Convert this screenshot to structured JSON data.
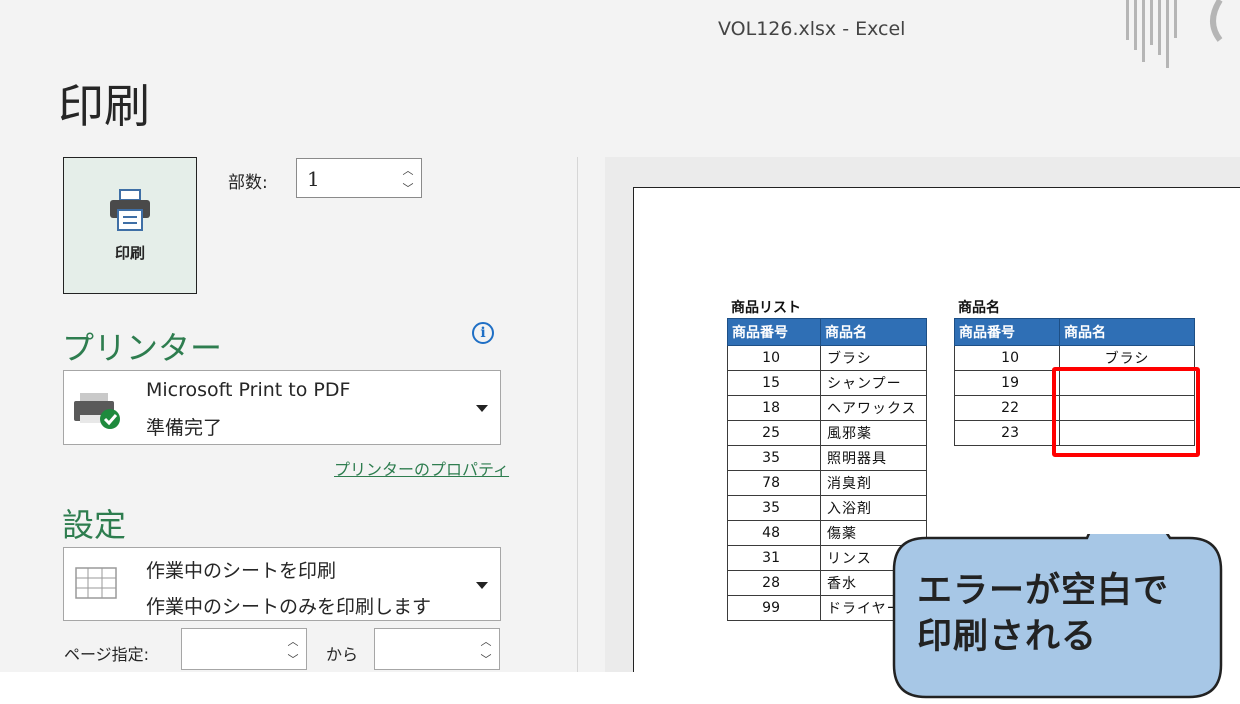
{
  "window": {
    "title": "VOL126.xlsx  -  Excel"
  },
  "page": {
    "title": "印刷"
  },
  "print_button": {
    "label": "印刷",
    "icon": "printer-icon"
  },
  "copies": {
    "label": "部数:",
    "value": "1"
  },
  "printer": {
    "heading": "プリンター",
    "name": "Microsoft Print to PDF",
    "status": "準備完了",
    "properties_link": "プリンターのプロパティ",
    "info_icon": "info-icon"
  },
  "settings": {
    "heading": "設定",
    "scope_title": "作業中のシートを印刷",
    "scope_desc": "作業中のシートのみを印刷します",
    "pages_label": "ページ指定:",
    "pages_to": "から"
  },
  "preview": {
    "list_title": "商品リスト",
    "list_headers": [
      "商品番号",
      "商品名"
    ],
    "list_rows": [
      [
        "10",
        "ブラシ"
      ],
      [
        "15",
        "シャンプー"
      ],
      [
        "18",
        "ヘアワックス"
      ],
      [
        "25",
        "風邪薬"
      ],
      [
        "35",
        "照明器具"
      ],
      [
        "78",
        "消臭剤"
      ],
      [
        "35",
        "入浴剤"
      ],
      [
        "48",
        "傷薬"
      ],
      [
        "31",
        "リンス"
      ],
      [
        "28",
        "香水"
      ],
      [
        "99",
        "ドライヤー"
      ]
    ],
    "lookup_title": "商品名",
    "lookup_headers": [
      "商品番号",
      "商品名"
    ],
    "lookup_rows": [
      [
        "10",
        "ブラシ"
      ],
      [
        "19",
        ""
      ],
      [
        "22",
        ""
      ],
      [
        "23",
        ""
      ]
    ]
  },
  "callout": {
    "line1": "エラーが空白で",
    "line2": "印刷される"
  },
  "colors": {
    "accent": "#2e7d4f",
    "header_blue": "#2f6fb5",
    "highlight_red": "#ff0000",
    "callout_fill": "#a7c7e6"
  }
}
